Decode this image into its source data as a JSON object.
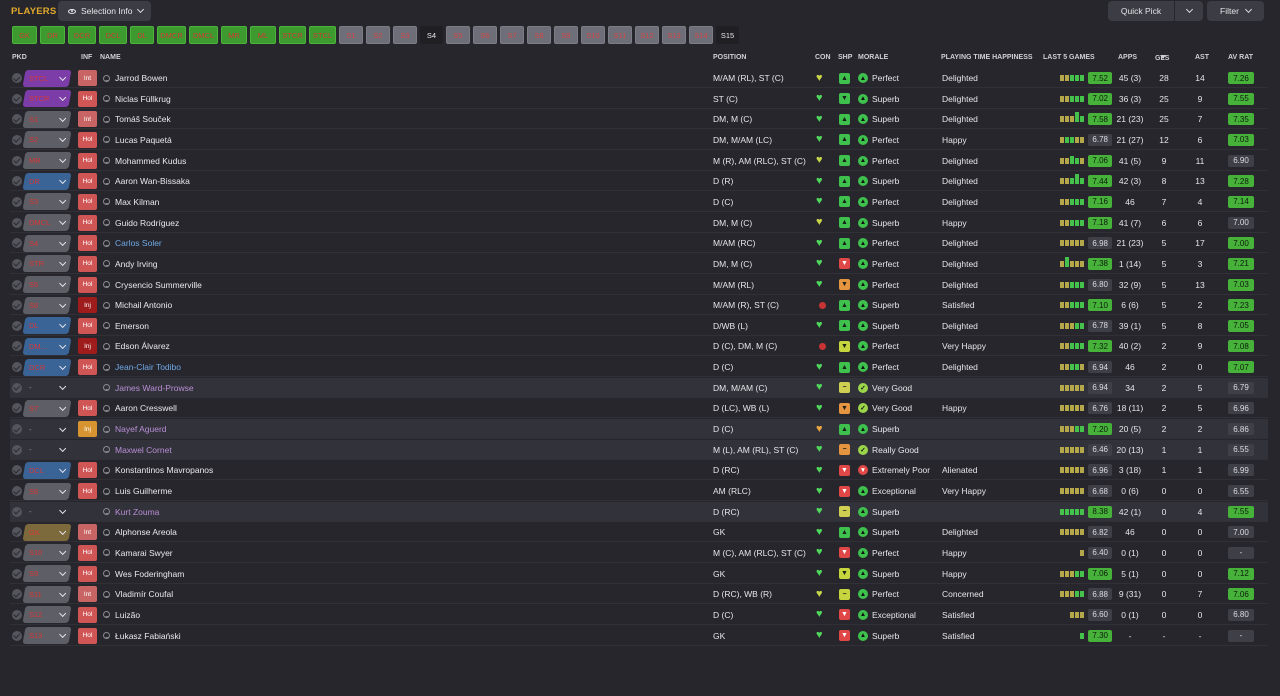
{
  "header": {
    "title": "PLAYERS",
    "selection_info": "Selection Info",
    "quick_pick": "Quick Pick",
    "filter": "Filter"
  },
  "positions": [
    "GK",
    "DR",
    "DCR",
    "DCL",
    "DL",
    "DMCR",
    "DMCL",
    "MR",
    "ML",
    "STCR",
    "STCL",
    "S1",
    "S2",
    "S3",
    "S4",
    "S5",
    "S6",
    "S7",
    "S8",
    "S9",
    "S10",
    "S11",
    "S12",
    "S13",
    "S14",
    "S15"
  ],
  "columns": {
    "pkd": "PKD",
    "inf": "INF",
    "name": "NAME",
    "position": "POSITION",
    "con": "CON",
    "shp": "SHP",
    "morale": "MORALE",
    "pth": "PLAYING TIME HAPPINESS",
    "last5": "LAST 5 GAMES",
    "apps": "APPS",
    "gls": "GLS",
    "ast": "AST",
    "avrat": "AV RAT"
  },
  "colors": {
    "accent": "#e2a92c",
    "good": "#46b23a",
    "bad": "#e04848"
  },
  "players": [
    {
      "pkd": "STCL",
      "pkdc": "#7d3da8",
      "inf": "Int",
      "infc": "int",
      "name": "Jarrod Bowen",
      "nc": "",
      "pos": "M/AM (RL), ST (C)",
      "con": "yl",
      "shp": "g",
      "shp_icon": "▲",
      "mor": "Perfect",
      "mc": "g",
      "mi": "▲",
      "pth": "Delighted",
      "bars": [
        "y",
        "y",
        "g",
        "g",
        "g"
      ],
      "bh": [
        "",
        "",
        "",
        "",
        ""
      ],
      "l5": "7.52",
      "l5c": "g",
      "apps": "45 (3)",
      "gls": "28",
      "ast": "14",
      "av": "7.26",
      "avc": "g"
    },
    {
      "pkd": "STCR",
      "pkdc": "#7d3da8",
      "inf": "Hol",
      "infc": "hol",
      "name": "Niclas Füllkrug",
      "nc": "",
      "pos": "ST (C)",
      "con": "g",
      "shp": "g",
      "shp_icon": "▼",
      "mor": "Superb",
      "mc": "g",
      "mi": "▲",
      "pth": "Delighted",
      "bars": [
        "y",
        "y",
        "g",
        "g",
        "g"
      ],
      "bh": [
        "",
        "",
        "",
        "",
        ""
      ],
      "l5": "7.02",
      "l5c": "g",
      "apps": "36 (3)",
      "gls": "25",
      "ast": "9",
      "av": "7.55",
      "avc": "g"
    },
    {
      "pkd": "S1",
      "pkdc": "#5e5e66",
      "inf": "Int",
      "infc": "int",
      "name": "Tomáš Souček",
      "nc": "",
      "pos": "DM, M (C)",
      "con": "g",
      "shp": "g",
      "shp_icon": "▲",
      "mor": "Superb",
      "mc": "g",
      "mi": "▲",
      "pth": "Delighted",
      "bars": [
        "y",
        "y",
        "y",
        "g",
        "g"
      ],
      "bh": [
        "",
        "",
        "",
        "t",
        ""
      ],
      "l5": "7.58",
      "l5c": "g",
      "apps": "21 (23)",
      "gls": "25",
      "ast": "7",
      "av": "7.35",
      "avc": "g"
    },
    {
      "pkd": "S2",
      "pkdc": "#5e5e66",
      "inf": "Hol",
      "infc": "hol",
      "name": "Lucas Paquetá",
      "nc": "",
      "pos": "DM, M/AM (LC)",
      "con": "g",
      "shp": "g",
      "shp_icon": "▲",
      "mor": "Perfect",
      "mc": "g",
      "mi": "▲",
      "pth": "Happy",
      "bars": [
        "y",
        "g",
        "g",
        "y",
        "y"
      ],
      "bh": [
        "",
        "",
        "",
        "",
        ""
      ],
      "l5": "6.78",
      "l5c": "d",
      "apps": "21 (27)",
      "gls": "12",
      "ast": "6",
      "av": "7.03",
      "avc": "g"
    },
    {
      "pkd": "MR",
      "pkdc": "#5e5e66",
      "inf": "Hol",
      "infc": "hol",
      "name": "Mohammed Kudus",
      "nc": "",
      "pos": "M (R), AM (RLC), ST (C)",
      "con": "yl",
      "shp": "g",
      "shp_icon": "▲",
      "mor": "Perfect",
      "mc": "g",
      "mi": "▲",
      "pth": "Delighted",
      "bars": [
        "y",
        "y",
        "g",
        "g",
        "y"
      ],
      "bh": [
        "",
        "",
        "m",
        "",
        ""
      ],
      "l5": "7.06",
      "l5c": "g",
      "apps": "41 (5)",
      "gls": "9",
      "ast": "11",
      "av": "6.90",
      "avc": "d"
    },
    {
      "pkd": "DR",
      "pkdc": "#3a6496",
      "inf": "Hol",
      "infc": "hol",
      "name": "Aaron Wan-Bissaka",
      "nc": "",
      "pos": "D (R)",
      "con": "g",
      "shp": "g",
      "shp_icon": "▲",
      "mor": "Superb",
      "mc": "g",
      "mi": "▲",
      "pth": "Delighted",
      "bars": [
        "y",
        "y",
        "g",
        "g",
        "g"
      ],
      "bh": [
        "",
        "",
        "",
        "t",
        ""
      ],
      "l5": "7.44",
      "l5c": "g",
      "apps": "42 (3)",
      "gls": "8",
      "ast": "13",
      "av": "7.28",
      "avc": "g"
    },
    {
      "pkd": "S3",
      "pkdc": "#5e5e66",
      "inf": "Hol",
      "infc": "hol",
      "name": "Max Kilman",
      "nc": "",
      "pos": "D (C)",
      "con": "g",
      "shp": "g",
      "shp_icon": "▲",
      "mor": "Perfect",
      "mc": "g",
      "mi": "▲",
      "pth": "Delighted",
      "bars": [
        "y",
        "y",
        "g",
        "g",
        "g"
      ],
      "bh": [
        "",
        "",
        "",
        "",
        ""
      ],
      "l5": "7.16",
      "l5c": "g",
      "apps": "46",
      "gls": "7",
      "ast": "4",
      "av": "7.14",
      "avc": "g"
    },
    {
      "pkd": "DMCL",
      "pkdc": "#5e5e66",
      "inf": "Hol",
      "infc": "hol",
      "name": "Guido Rodríguez",
      "nc": "",
      "pos": "DM, M (C)",
      "con": "yl",
      "shp": "g",
      "shp_icon": "▲",
      "mor": "Superb",
      "mc": "g",
      "mi": "▲",
      "pth": "Happy",
      "bars": [
        "y",
        "y",
        "g",
        "g",
        "g"
      ],
      "bh": [
        "",
        "",
        "",
        "",
        ""
      ],
      "l5": "7.18",
      "l5c": "g",
      "apps": "41 (7)",
      "gls": "6",
      "ast": "6",
      "av": "7.00",
      "avc": "d"
    },
    {
      "pkd": "S4",
      "pkdc": "#5e5e66",
      "inf": "Hol",
      "infc": "hol",
      "name": "Carlos Soler",
      "nc": "blue",
      "pos": "M/AM (RC)",
      "con": "g",
      "shp": "g",
      "shp_icon": "▲",
      "mor": "Perfect",
      "mc": "g",
      "mi": "▲",
      "pth": "Delighted",
      "bars": [
        "y",
        "y",
        "y",
        "y",
        "y"
      ],
      "bh": [
        "",
        "",
        "",
        "",
        ""
      ],
      "l5": "6.98",
      "l5c": "d",
      "apps": "21 (23)",
      "gls": "5",
      "ast": "17",
      "av": "7.00",
      "avc": "g"
    },
    {
      "pkd": "STR",
      "pkdc": "#5e5e66",
      "inf": "Hol",
      "infc": "hol",
      "name": "Andy Irving",
      "nc": "",
      "pos": "DM, M (C)",
      "con": "g",
      "shp": "r",
      "shp_icon": "▼",
      "mor": "Perfect",
      "mc": "g",
      "mi": "▲",
      "pth": "Delighted",
      "bars": [
        "y",
        "g",
        "y",
        "y",
        "y"
      ],
      "bh": [
        "",
        "t",
        "",
        "",
        ""
      ],
      "l5": "7.38",
      "l5c": "g",
      "apps": "1 (14)",
      "gls": "5",
      "ast": "3",
      "av": "7.21",
      "avc": "g"
    },
    {
      "pkd": "S5",
      "pkdc": "#5e5e66",
      "inf": "Hol",
      "infc": "hol",
      "name": "Crysencio Summerville",
      "nc": "",
      "pos": "M/AM (RL)",
      "con": "g",
      "shp": "o",
      "shp_icon": "▼",
      "mor": "Perfect",
      "mc": "g",
      "mi": "▲",
      "pth": "Delighted",
      "bars": [
        "y",
        "y",
        "g",
        "g",
        "g"
      ],
      "bh": [
        "",
        "",
        "",
        "",
        ""
      ],
      "l5": "6.80",
      "l5c": "d",
      "apps": "32 (9)",
      "gls": "5",
      "ast": "13",
      "av": "7.03",
      "avc": "g"
    },
    {
      "pkd": "S6",
      "pkdc": "#5e5e66",
      "inf": "Inj",
      "infc": "inj",
      "name": "Michail Antonio",
      "nc": "",
      "pos": "M/AM (R), ST (C)",
      "con": "dot",
      "shp": "g",
      "shp_icon": "▲",
      "mor": "Superb",
      "mc": "g",
      "mi": "▲",
      "pth": "Satisfied",
      "bars": [
        "y",
        "y",
        "g",
        "g",
        "g"
      ],
      "bh": [
        "",
        "",
        "",
        "",
        ""
      ],
      "l5": "7.10",
      "l5c": "g",
      "apps": "6 (6)",
      "gls": "5",
      "ast": "2",
      "av": "7.23",
      "avc": "g"
    },
    {
      "pkd": "DL",
      "pkdc": "#3a6496",
      "inf": "Hol",
      "infc": "hol",
      "name": "Emerson",
      "nc": "",
      "pos": "D/WB (L)",
      "con": "g",
      "shp": "g",
      "shp_icon": "▲",
      "mor": "Superb",
      "mc": "g",
      "mi": "▲",
      "pth": "Delighted",
      "bars": [
        "y",
        "y",
        "y",
        "g",
        "g"
      ],
      "bh": [
        "",
        "",
        "",
        "",
        ""
      ],
      "l5": "6.78",
      "l5c": "d",
      "apps": "39 (1)",
      "gls": "5",
      "ast": "8",
      "av": "7.05",
      "avc": "g"
    },
    {
      "pkd": "DM...",
      "pkdc": "#3a6496",
      "inf": "Inj",
      "infc": "inj",
      "name": "Edson Álvarez",
      "nc": "",
      "pos": "D (C), DM, M (C)",
      "con": "dot",
      "shp": "y",
      "shp_icon": "▼",
      "mor": "Perfect",
      "mc": "g",
      "mi": "▲",
      "pth": "Very Happy",
      "bars": [
        "y",
        "y",
        "g",
        "g",
        "g"
      ],
      "bh": [
        "",
        "",
        "",
        "",
        ""
      ],
      "l5": "7.32",
      "l5c": "g",
      "apps": "40 (2)",
      "gls": "2",
      "ast": "9",
      "av": "7.08",
      "avc": "g"
    },
    {
      "pkd": "DCR",
      "pkdc": "#3a6496",
      "inf": "Hol",
      "infc": "hol",
      "name": "Jean-Clair Todibo",
      "nc": "blue",
      "pos": "D (C)",
      "con": "g",
      "shp": "g",
      "shp_icon": "▲",
      "mor": "Perfect",
      "mc": "g",
      "mi": "▲",
      "pth": "Delighted",
      "bars": [
        "y",
        "y",
        "g",
        "g",
        "y"
      ],
      "bh": [
        "",
        "",
        "",
        "",
        ""
      ],
      "l5": "6.94",
      "l5c": "d",
      "apps": "46",
      "gls": "2",
      "ast": "0",
      "av": "7.07",
      "avc": "g"
    },
    {
      "pkd": "-",
      "pkdc": "none",
      "inf": "",
      "infc": "",
      "name": "James Ward-Prowse",
      "nc": "purple",
      "pos": "DM, M/AM (C)",
      "con": "g",
      "shp": "n",
      "shp_icon": "−",
      "mor": "Very Good",
      "mc": "lg",
      "mi": "✓",
      "pth": "",
      "bars": [
        "y",
        "y",
        "y",
        "y",
        "y"
      ],
      "bh": [
        "",
        "",
        "",
        "",
        ""
      ],
      "l5": "6.94",
      "l5c": "d",
      "apps": "34",
      "gls": "2",
      "ast": "5",
      "av": "6.79",
      "avc": "d"
    },
    {
      "pkd": "S7",
      "pkdc": "#5e5e66",
      "inf": "Hol",
      "infc": "hol",
      "name": "Aaron Cresswell",
      "nc": "",
      "pos": "D (LC), WB (L)",
      "con": "g",
      "shp": "o",
      "shp_icon": "▼",
      "mor": "Very Good",
      "mc": "lg",
      "mi": "✓",
      "pth": "Happy",
      "bars": [
        "y",
        "y",
        "y",
        "y",
        "y"
      ],
      "bh": [
        "",
        "",
        "",
        "",
        ""
      ],
      "l5": "6.76",
      "l5c": "d",
      "apps": "18 (11)",
      "gls": "2",
      "ast": "5",
      "av": "6.96",
      "avc": "d"
    },
    {
      "pkd": "-",
      "pkdc": "none",
      "inf": "Inj",
      "infc": "injo",
      "name": "Nayef Aguerd",
      "nc": "purple",
      "pos": "D (C)",
      "con": "or",
      "shp": "g",
      "shp_icon": "▲",
      "mor": "Superb",
      "mc": "g",
      "mi": "▲",
      "pth": "",
      "bars": [
        "y",
        "y",
        "y",
        "g",
        "g"
      ],
      "bh": [
        "",
        "",
        "",
        "",
        ""
      ],
      "l5": "7.20",
      "l5c": "g",
      "apps": "20 (5)",
      "gls": "2",
      "ast": "2",
      "av": "6.86",
      "avc": "d"
    },
    {
      "pkd": "-",
      "pkdc": "none",
      "inf": "",
      "infc": "",
      "name": "Maxwel Cornet",
      "nc": "purple",
      "pos": "M (L), AM (RL), ST (C)",
      "con": "g",
      "shp": "o",
      "shp_icon": "−",
      "mor": "Really Good",
      "mc": "lg",
      "mi": "✓",
      "pth": "",
      "bars": [
        "y",
        "y",
        "y",
        "y",
        "y"
      ],
      "bh": [
        "",
        "",
        "",
        "",
        ""
      ],
      "l5": "6.46",
      "l5c": "d",
      "apps": "20 (13)",
      "gls": "1",
      "ast": "1",
      "av": "6.55",
      "avc": "d"
    },
    {
      "pkd": "DCL",
      "pkdc": "#3a6496",
      "inf": "Hol",
      "infc": "hol",
      "name": "Konstantinos Mavropanos",
      "nc": "",
      "pos": "D (RC)",
      "con": "g",
      "shp": "r",
      "shp_icon": "▼",
      "mor": "Extremely Poor",
      "mc": "r",
      "mi": "▼",
      "pth": "Alienated",
      "bars": [
        "y",
        "y",
        "y",
        "y",
        "y"
      ],
      "bh": [
        "",
        "",
        "",
        "",
        ""
      ],
      "l5": "6.96",
      "l5c": "d",
      "apps": "3 (18)",
      "gls": "1",
      "ast": "1",
      "av": "6.99",
      "avc": "d"
    },
    {
      "pkd": "S8",
      "pkdc": "#5e5e66",
      "inf": "Hol",
      "infc": "hol",
      "name": "Luis Guilherme",
      "nc": "",
      "pos": "AM (RLC)",
      "con": "g",
      "shp": "r",
      "shp_icon": "▼",
      "mor": "Exceptional",
      "mc": "g",
      "mi": "▲",
      "pth": "Very Happy",
      "bars": [
        "y",
        "y",
        "y",
        "y",
        "y"
      ],
      "bh": [
        "",
        "",
        "",
        "",
        ""
      ],
      "l5": "6.68",
      "l5c": "d",
      "apps": "0 (6)",
      "gls": "0",
      "ast": "0",
      "av": "6.55",
      "avc": "d"
    },
    {
      "pkd": "-",
      "pkdc": "none",
      "inf": "",
      "infc": "",
      "name": "Kurt Zouma",
      "nc": "purple",
      "pos": "D (RC)",
      "con": "g",
      "shp": "n",
      "shp_icon": "−",
      "mor": "Superb",
      "mc": "g",
      "mi": "▲",
      "pth": "",
      "bars": [
        "g",
        "g",
        "g",
        "g",
        "g"
      ],
      "bh": [
        "",
        "",
        "",
        "",
        ""
      ],
      "l5": "8.38",
      "l5c": "g",
      "apps": "42 (1)",
      "gls": "0",
      "ast": "4",
      "av": "7.55",
      "avc": "g"
    },
    {
      "pkd": "GK",
      "pkdc": "#7c6a3c",
      "inf": "Int",
      "infc": "int",
      "name": "Alphonse Areola",
      "nc": "",
      "pos": "GK",
      "con": "g",
      "shp": "g",
      "shp_icon": "▲",
      "mor": "Superb",
      "mc": "g",
      "mi": "▲",
      "pth": "Delighted",
      "bars": [
        "y",
        "y",
        "y",
        "y",
        "y"
      ],
      "bh": [
        "",
        "",
        "",
        "",
        ""
      ],
      "l5": "6.82",
      "l5c": "d",
      "apps": "46",
      "gls": "0",
      "ast": "0",
      "av": "7.00",
      "avc": "d"
    },
    {
      "pkd": "S10",
      "pkdc": "#5e5e66",
      "inf": "Hol",
      "infc": "hol",
      "name": "Kamarai Swyer",
      "nc": "",
      "pos": "M (C), AM (RLC), ST (C)",
      "con": "g",
      "shp": "r",
      "shp_icon": "▼",
      "mor": "Perfect",
      "mc": "g",
      "mi": "▲",
      "pth": "Happy",
      "bars": [
        "y"
      ],
      "bh": [
        ""
      ],
      "l5": "6.40",
      "l5c": "d",
      "apps": "0 (1)",
      "gls": "0",
      "ast": "0",
      "av": "-",
      "avc": "d"
    },
    {
      "pkd": "S9",
      "pkdc": "#5e5e66",
      "inf": "Hol",
      "infc": "hol",
      "name": "Wes Foderingham",
      "nc": "",
      "pos": "GK",
      "con": "g",
      "shp": "y",
      "shp_icon": "▼",
      "mor": "Superb",
      "mc": "g",
      "mi": "▲",
      "pth": "Happy",
      "bars": [
        "y",
        "y",
        "y",
        "g",
        "g"
      ],
      "bh": [
        "",
        "",
        "",
        "",
        ""
      ],
      "l5": "7.06",
      "l5c": "g",
      "apps": "5 (1)",
      "gls": "0",
      "ast": "0",
      "av": "7.12",
      "avc": "g"
    },
    {
      "pkd": "S11",
      "pkdc": "#5e5e66",
      "inf": "Int",
      "infc": "int",
      "name": "Vladimír Coufal",
      "nc": "",
      "pos": "D (RC), WB (R)",
      "con": "yl",
      "shp": "y",
      "shp_icon": "−",
      "mor": "Perfect",
      "mc": "g",
      "mi": "▲",
      "pth": "Concerned",
      "bars": [
        "y",
        "y",
        "y",
        "g",
        "g"
      ],
      "bh": [
        "",
        "",
        "",
        "",
        ""
      ],
      "l5": "6.88",
      "l5c": "d",
      "apps": "9 (31)",
      "gls": "0",
      "ast": "7",
      "av": "7.06",
      "avc": "g"
    },
    {
      "pkd": "S12",
      "pkdc": "#5e5e66",
      "inf": "Hol",
      "infc": "hol",
      "name": "Luizão",
      "nc": "",
      "pos": "D (C)",
      "con": "g",
      "shp": "r",
      "shp_icon": "▼",
      "mor": "Exceptional",
      "mc": "g",
      "mi": "▲",
      "pth": "Satisfied",
      "bars": [
        "y",
        "y",
        "y"
      ],
      "bh": [
        "",
        "",
        ""
      ],
      "l5": "6.60",
      "l5c": "d",
      "apps": "0 (1)",
      "gls": "0",
      "ast": "0",
      "av": "6.80",
      "avc": "d"
    },
    {
      "pkd": "S13",
      "pkdc": "#5e5e66",
      "inf": "Hol",
      "infc": "hol",
      "name": "Łukasz Fabiański",
      "nc": "",
      "pos": "GK",
      "con": "g",
      "shp": "r",
      "shp_icon": "▼",
      "mor": "Superb",
      "mc": "g",
      "mi": "▲",
      "pth": "Satisfied",
      "bars": [
        "g"
      ],
      "bh": [
        ""
      ],
      "l5": "7.30",
      "l5c": "g",
      "apps": "-",
      "gls": "-",
      "ast": "-",
      "av": "-",
      "avc": "d"
    }
  ]
}
